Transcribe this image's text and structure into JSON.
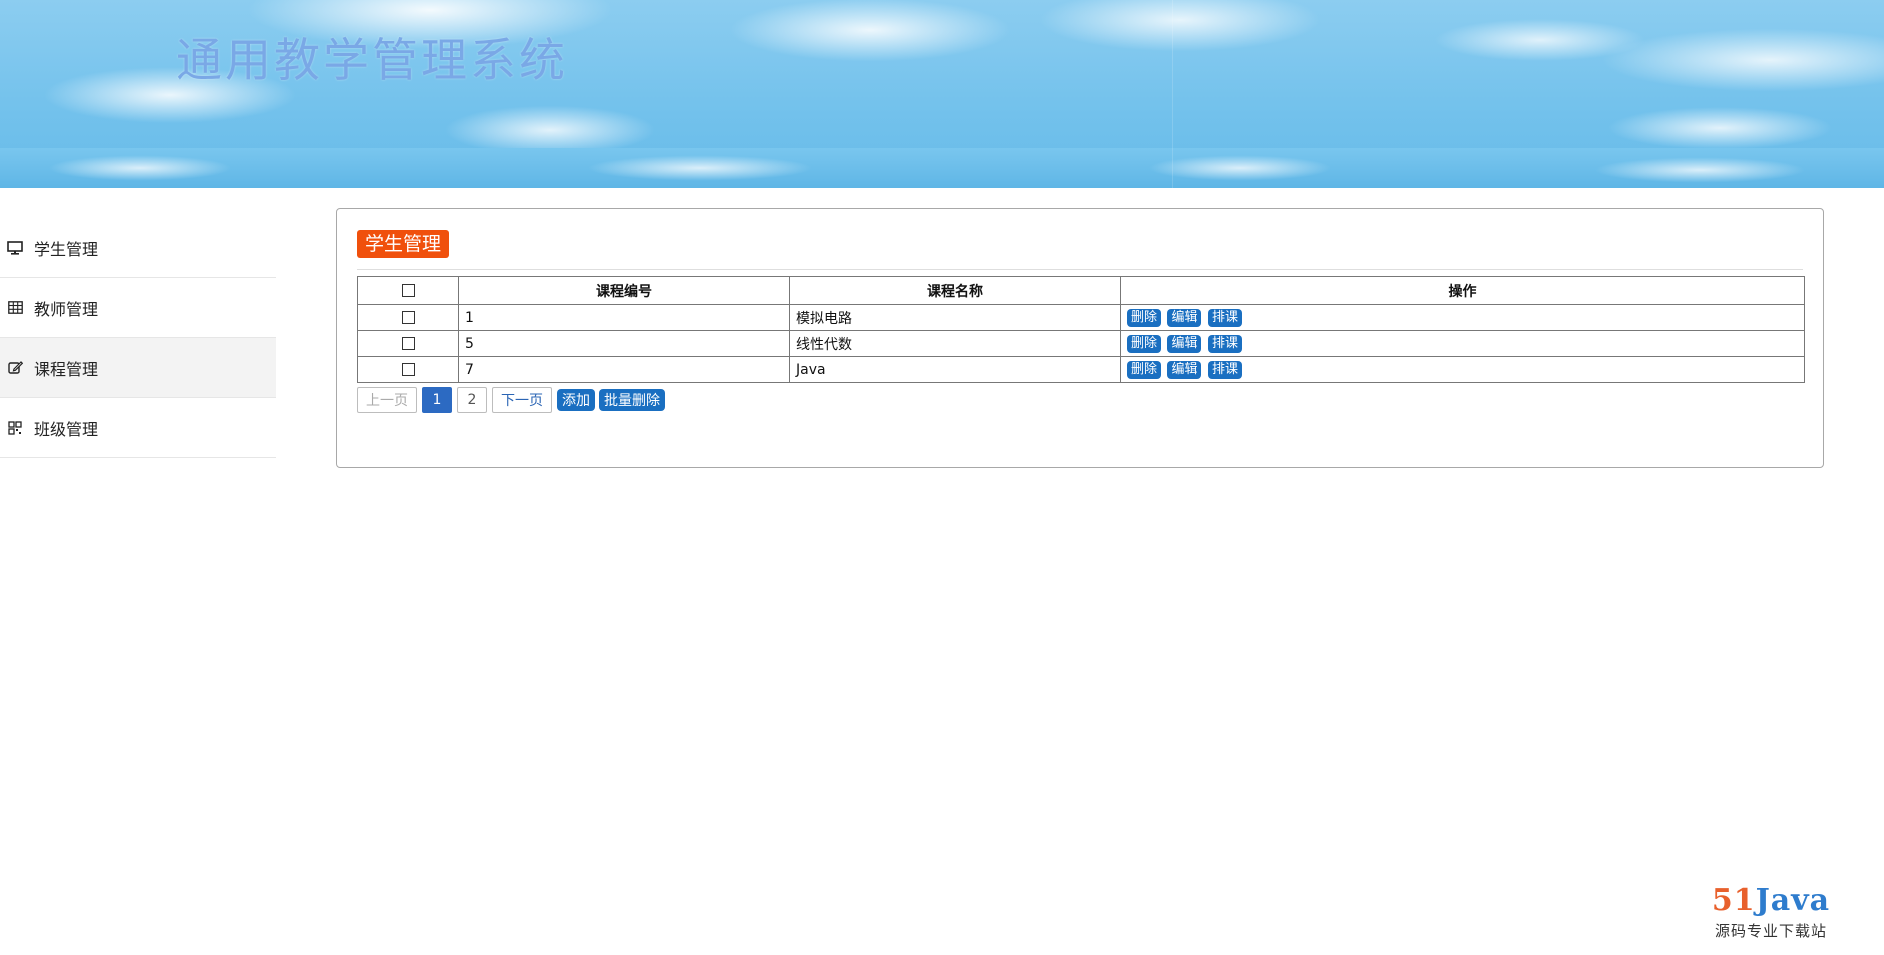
{
  "header": {
    "site_title": "通用教学管理系统"
  },
  "sidebar": {
    "items": [
      {
        "label": "学生管理",
        "icon": "monitor-icon",
        "active": false
      },
      {
        "label": "教师管理",
        "icon": "table-icon",
        "active": false
      },
      {
        "label": "课程管理",
        "icon": "edit-icon",
        "active": true
      },
      {
        "label": "班级管理",
        "icon": "grid-icon",
        "active": false
      }
    ]
  },
  "panel": {
    "title": "学生管理",
    "table": {
      "columns": [
        "课程编号",
        "课程名称",
        "操作"
      ],
      "rows": [
        {
          "id": "1",
          "name": "模拟电路"
        },
        {
          "id": "5",
          "name": "线性代数"
        },
        {
          "id": "7",
          "name": "Java"
        }
      ],
      "row_actions": {
        "delete": "删除",
        "edit": "编辑",
        "schedule": "排课"
      }
    },
    "pager": {
      "prev": "上一页",
      "pages": [
        "1",
        "2"
      ],
      "current_page": "1",
      "next": "下一页"
    },
    "actions": {
      "add": "添加",
      "batch_delete": "批量删除"
    }
  },
  "watermark": {
    "logo_num": "51",
    "logo_word": "Java",
    "subtitle": "源码专业下载站"
  },
  "colors": {
    "title_badge": "#f0500c",
    "button_blue": "#1a6fc1",
    "page_current": "#2c6ac2",
    "site_title": "#7aa8e6"
  }
}
